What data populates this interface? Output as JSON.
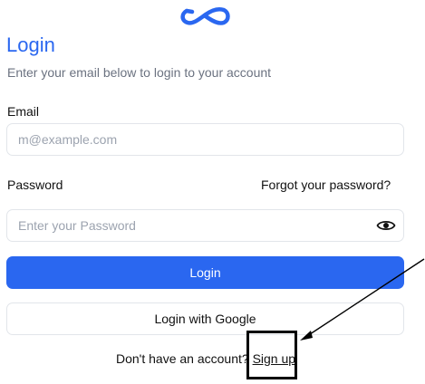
{
  "logo": {
    "icon": "infinity-logo-icon",
    "color": "#2a67f0"
  },
  "header": {
    "title": "Login",
    "subtitle": "Enter your email below to login to your account"
  },
  "email": {
    "label": "Email",
    "placeholder": "m@example.com",
    "value": ""
  },
  "password": {
    "label": "Password",
    "forgot_label": "Forgot your password?",
    "placeholder": "Enter your Password",
    "value": "",
    "toggle_icon": "eye-icon"
  },
  "actions": {
    "login_label": "Login",
    "google_label": "Login with Google"
  },
  "footer": {
    "prompt": "Don't have an account?",
    "signup_label": "Sign up"
  },
  "colors": {
    "accent": "#2a67f0",
    "border": "#e2e5ea",
    "muted_text": "#6b7280"
  }
}
